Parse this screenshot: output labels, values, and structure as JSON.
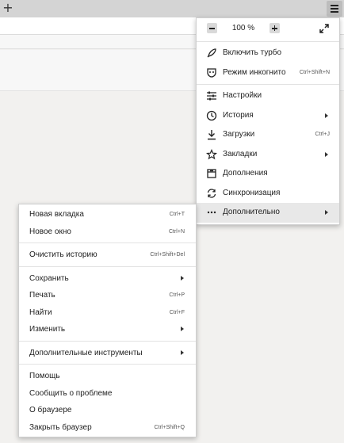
{
  "toolbar": {
    "new_tab_glyph": "+",
    "menu_icon": "hamburger-icon"
  },
  "zoom": {
    "value": "100 %"
  },
  "main_menu": {
    "items": [
      {
        "label": "Включить турбо",
        "icon": "rocket-icon",
        "shortcut": "",
        "submenu": false
      },
      {
        "label": "Режим инкогнито",
        "icon": "incognito-icon",
        "shortcut": "Ctrl+Shift+N",
        "submenu": false
      },
      {
        "label": "Настройки",
        "icon": "settings-sliders-icon",
        "shortcut": "",
        "submenu": false
      },
      {
        "label": "История",
        "icon": "clock-icon",
        "shortcut": "",
        "submenu": true
      },
      {
        "label": "Загрузки",
        "icon": "download-icon",
        "shortcut": "Ctrl+J",
        "submenu": false
      },
      {
        "label": "Закладки",
        "icon": "star-icon",
        "shortcut": "",
        "submenu": true
      },
      {
        "label": "Дополнения",
        "icon": "extensions-icon",
        "shortcut": "",
        "submenu": false
      },
      {
        "label": "Синхронизация",
        "icon": "sync-icon",
        "shortcut": "",
        "submenu": false
      },
      {
        "label": "Дополнительно",
        "icon": "more-dots-icon",
        "shortcut": "",
        "submenu": true
      }
    ]
  },
  "sub_menu": {
    "items": [
      {
        "label": "Новая вкладка",
        "shortcut": "Ctrl+T"
      },
      {
        "label": "Новое окно",
        "shortcut": "Ctrl+N"
      },
      {
        "label": "Очистить историю",
        "shortcut": "Ctrl+Shift+Del"
      },
      {
        "label": "Сохранить",
        "shortcut": ""
      },
      {
        "label": "Печать",
        "shortcut": "Ctrl+P"
      },
      {
        "label": "Найти",
        "shortcut": "Ctrl+F"
      },
      {
        "label": "Изменить",
        "shortcut": ""
      },
      {
        "label": "Дополнительные инструменты",
        "shortcut": ""
      },
      {
        "label": "Помощь",
        "shortcut": ""
      },
      {
        "label": "Сообщить о проблеме",
        "shortcut": ""
      },
      {
        "label": "О браузере",
        "shortcut": ""
      },
      {
        "label": "Закрыть браузер",
        "shortcut": "Ctrl+Shift+Q"
      }
    ]
  }
}
